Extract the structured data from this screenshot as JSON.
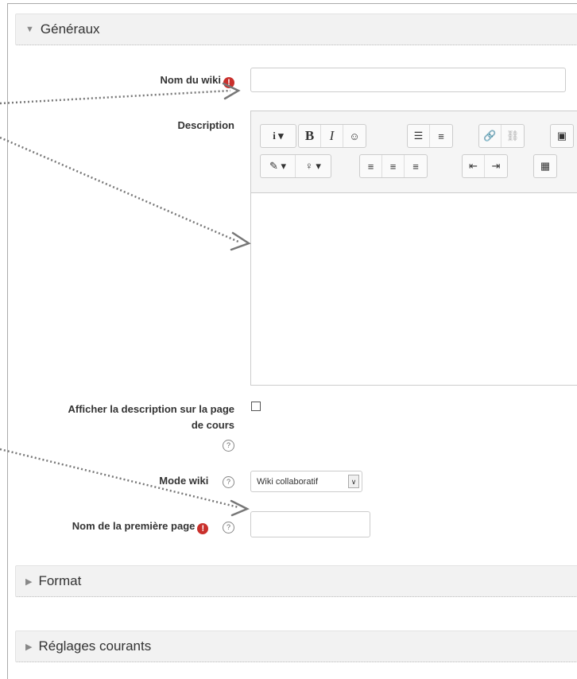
{
  "sections": {
    "general": "Généraux",
    "format": "Format",
    "common": "Réglages courants"
  },
  "fields": {
    "wiki_name_label": "Nom du wiki",
    "wiki_name_value": "",
    "description_label": "Description",
    "show_description_label_1": "Afficher la description sur la page",
    "show_description_label_2": "de cours",
    "show_description_checked": false,
    "wiki_mode_label": "Mode wiki",
    "wiki_mode_value": "Wiki collaboratif",
    "first_page_label": "Nom de la première page",
    "first_page_value": ""
  },
  "icons": {
    "required": "!",
    "help": "?",
    "caret_expanded": "▼",
    "caret_collapsed": "▶",
    "dropdown": "∨"
  },
  "toolbar": {
    "row1": [
      [
        "i ▾"
      ],
      [
        "B",
        "I",
        "☺"
      ],
      [
        "☰",
        "≡"
      ],
      [
        "🔗",
        "⛓"
      ],
      [
        "▣"
      ]
    ],
    "row2": [
      [
        "✎ ▾",
        "♀ ▾"
      ],
      [
        "≡",
        "≡",
        "≡"
      ],
      [
        "⇤",
        "⇥"
      ],
      [
        "▦"
      ]
    ]
  },
  "colors": {
    "header_bg": "#f2f2f2",
    "required": "#c9302c",
    "arrow": "#777777"
  }
}
